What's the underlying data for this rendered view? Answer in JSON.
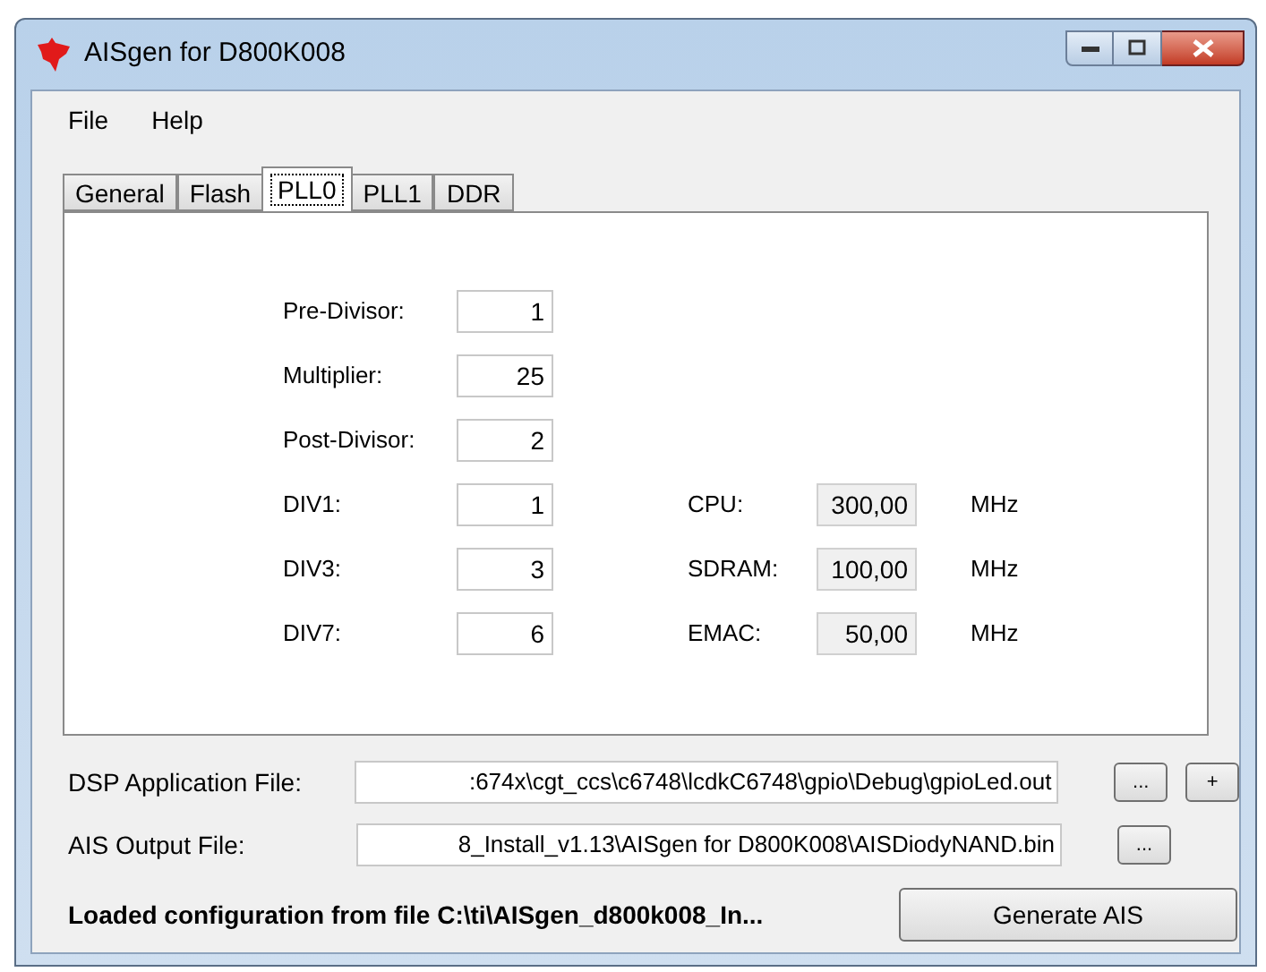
{
  "window": {
    "title": "AISgen for D800K008"
  },
  "menu": [
    "File",
    "Help"
  ],
  "tabs": [
    {
      "label": "General",
      "selected": false
    },
    {
      "label": "Flash",
      "selected": false
    },
    {
      "label": "PLL0",
      "selected": true
    },
    {
      "label": "PLL1",
      "selected": false
    },
    {
      "label": "DDR",
      "selected": false
    }
  ],
  "pll_fields": [
    {
      "label": "Pre-Divisor:",
      "value": "1"
    },
    {
      "label": "Multiplier:",
      "value": "25"
    },
    {
      "label": "Post-Divisor:",
      "value": "2"
    },
    {
      "label": "DIV1:",
      "value": "1"
    },
    {
      "label": "DIV3:",
      "value": "3"
    },
    {
      "label": "DIV7:",
      "value": "6"
    }
  ],
  "outputs": [
    {
      "label": "CPU:",
      "value": "300,00",
      "unit": "MHz"
    },
    {
      "label": "SDRAM:",
      "value": "100,00",
      "unit": "MHz"
    },
    {
      "label": "EMAC:",
      "value": "50,00",
      "unit": "MHz"
    }
  ],
  "files": [
    {
      "label": "DSP Application File:",
      "value": ":674x\\cgt_ccs\\c6748\\lcdkC6748\\gpio\\Debug\\gpioLed.out",
      "buttons": [
        "...",
        "+"
      ]
    },
    {
      "label": "AIS Output File:",
      "value": "8_Install_v1.13\\AISgen for D800K008\\AISDiodyNAND.bin",
      "buttons": [
        "..."
      ]
    }
  ],
  "status": "Loaded configuration from file C:\\ti\\AISgen_d800k008_In...",
  "generate_button": "Generate AIS"
}
